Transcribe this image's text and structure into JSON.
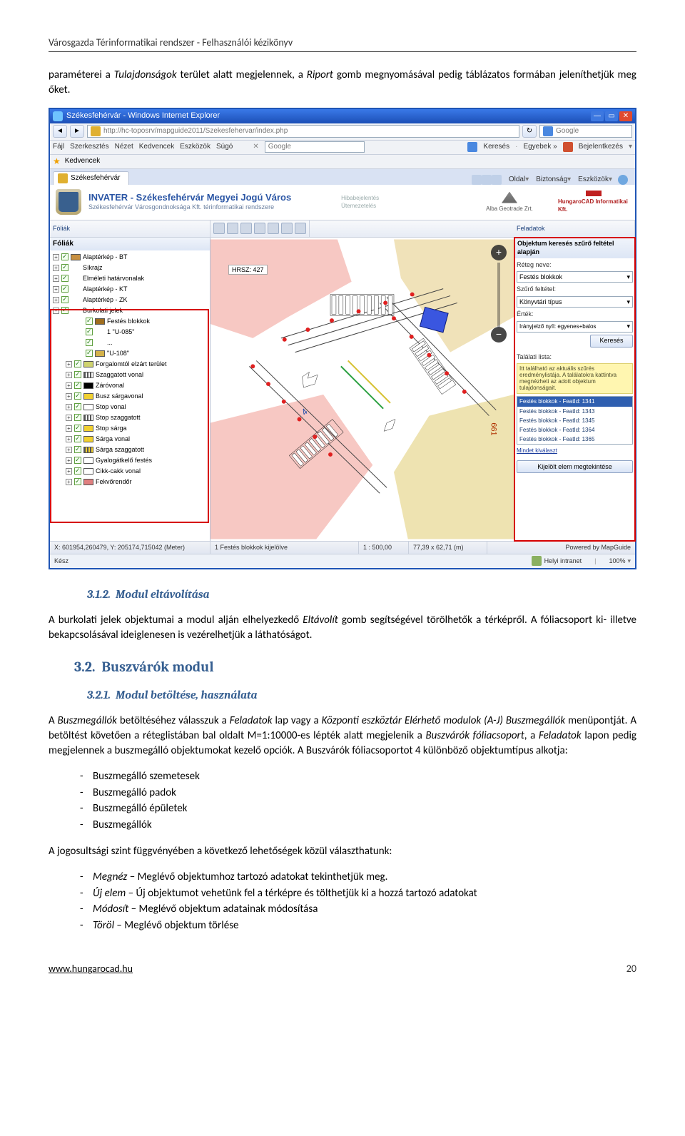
{
  "header": "Városgazda Térinformatikai rendszer - Felhasználói kézikönyv",
  "para1_a": "paraméterei a ",
  "para1_b": "Tulajdonságok",
  "para1_c": " terület alatt megjelennek, a ",
  "para1_d": "Riport",
  "para1_e": " gomb megnyomásával pedig táblázatos formában jeleníthetjük meg őket.",
  "screenshot": {
    "title": "Székesfehérvár - Windows Internet Explorer",
    "address": "http://hc-toposrv/mapguide2011/Szekesfehervar/index.php",
    "search_placeholder": "Google",
    "menu": [
      "Fájl",
      "Szerkesztés",
      "Nézet",
      "Kedvencek",
      "Eszközök",
      "Súgó"
    ],
    "google_box": "Google",
    "menu_right": [
      "Keresés",
      "Egyebek »",
      "Bejelentkezés"
    ],
    "fav_label": "Kedvencek",
    "tab": "Székesfehérvár",
    "tab_right": [
      "Oldal",
      "Biztonság",
      "Eszközök"
    ],
    "banner_title": "INVATER - Székesfehérvár Megyei Jogú Város",
    "banner_sub": "Székesfehérvár Városgondnoksága Kft. térinformatikai rendszere",
    "banner_mid": [
      "Hibabejelentés",
      "Ütemezetelés"
    ],
    "banner_logo1": "Alba Geotrade Zrt.",
    "banner_logo2": "HungaroCAD Informatikai Kft.",
    "toolbar_left": "Fóliák",
    "toolbar_right": "Feladatok",
    "layers_head": "Fóliák",
    "layers": [
      {
        "exp": "+",
        "label": "Alaptérkép - BT",
        "swatch": "#c89040"
      },
      {
        "exp": "+",
        "label": "Síkrajz",
        "swatch": ""
      },
      {
        "exp": "+",
        "label": "Elméleti határvonalak",
        "swatch": ""
      },
      {
        "exp": "+",
        "label": "Alaptérkép - KT",
        "swatch": ""
      },
      {
        "exp": "+",
        "label": "Alaptérkép - ZK",
        "swatch": ""
      },
      {
        "exp": "-",
        "label": "Burkolati jelek",
        "swatch": ""
      }
    ],
    "layers_children": [
      {
        "label": "Festés blokkok",
        "swatch": "#9f6e1f"
      },
      {
        "label": "1  \"U-085\""
      },
      {
        "label": "..."
      },
      {
        "label": "\"U-108\"",
        "swatch": "#d4b24a"
      },
      {
        "label": "Forgalomtól elzárt terület",
        "swatch": "#cfd36e"
      },
      {
        "label": "Szaggatott vonal",
        "swatch": "#ffffff",
        "dash": true
      },
      {
        "label": "Záróvonal",
        "swatch": "#000000"
      },
      {
        "label": "Busz sárgavonal",
        "swatch": "#f0d030"
      },
      {
        "label": "Stop vonal",
        "swatch": "#ffffff"
      },
      {
        "label": "Stop szaggatott",
        "swatch": "#ffffff",
        "dash": true
      },
      {
        "label": "Stop sárga",
        "swatch": "#f0d030"
      },
      {
        "label": "Sárga vonal",
        "swatch": "#f0d030"
      },
      {
        "label": "Sárga szaggatott",
        "swatch": "#f0d030",
        "dash": true
      },
      {
        "label": "Gyalogátkelő festés",
        "swatch": "#ffffff"
      },
      {
        "label": "Cikk-cakk vonal",
        "swatch": "#ffffff"
      },
      {
        "label": "Fekvőrendőr",
        "swatch": "#e08080"
      }
    ],
    "map_label": "HRSZ: 427",
    "right": {
      "head": "Objektum keresés szűrő feltétel alapján",
      "l1": "Réteg neve:",
      "v1": "Festés blokkok",
      "l2": "Szűrő feltétel:",
      "v2": "Könyvtári típus",
      "l3": "Érték:",
      "v3": "Irányjelző nyíl: egyenes+balos",
      "btn_search": "Keresés",
      "list_head": "Találati lista:",
      "tip": "Itt található az aktuális szűrés eredménylistája. A találatokra kattintva megnézheti az adott objektum tulajdonságait.",
      "items": [
        "Festés blokkok - FeatId: 1341",
        "Festés blokkok - FeatId: 1343",
        "Festés blokkok - FeatId: 1345",
        "Festés blokkok - FeatId: 1364",
        "Festés blokkok - FeatId: 1365"
      ],
      "link": "Mindet kiválaszt",
      "btn_view": "Kijelölt elem megtekintése"
    },
    "status": {
      "coord": "X: 601954,260479, Y: 205174,715042 (Meter)",
      "info": "1 Festés blokkok kijelölve",
      "scale": "1 : 500,00",
      "size": "77,39 x 62,71 (m)",
      "powered": "Powered by  MapGuide"
    },
    "bottom": {
      "left": "Kész",
      "intranet": "Helyi intranet",
      "zoom": "100%"
    }
  },
  "sec312_num": "3.1.2.",
  "sec312_title": "Modul eltávolítása",
  "para2_a": "A burkolati jelek objektumai a modul alján elhelyezkedő ",
  "para2_b": "Eltávolít",
  "para2_c": " gomb segítségével törölhetők a térképről. A fóliacsoport ki- illetve bekapcsolásával ideiglenesen is vezérelhetjük a láthatóságot.",
  "sec32_num": "3.2.",
  "sec32_title": "Buszvárók modul",
  "sec321_num": "3.2.1.",
  "sec321_title": "Modul betöltése, használata",
  "para3_a": "A ",
  "para3_b": "Buszmegállók",
  "para3_c": " betöltéséhez válasszuk a ",
  "para3_d": "Feladatok",
  "para3_e": " lap vagy a ",
  "para3_f": "Központi eszköztár Elérhető modulok (A-J) Buszmegállók",
  "para3_g": " menüpontját. A betöltést követően a réteglistában bal oldalt M=1:10000-es lépték alatt megjelenik a ",
  "para3_h": "Buszvárók fóliacsoport",
  "para3_i": ", a ",
  "para3_j": "Feladatok",
  "para3_k": " lapon pedig megjelennek a buszmegálló objektumokat kezelő opciók. A Buszvárók fóliacsoportot 4 különböző objektumtípus alkotja:",
  "list1": [
    "Buszmegálló szemetesek",
    "Buszmegálló padok",
    "Buszmegálló épületek",
    "Buszmegállók"
  ],
  "para4": "A jogosultsági szint függvényében a következő lehetőségek közül választhatunk:",
  "list2": [
    {
      "a": "Megnéz",
      "b": " – Meglévő objektumhoz tartozó adatokat tekinthetjük meg."
    },
    {
      "a": "Új elem",
      "b": " – Új objektumot vehetünk fel a térképre és tölthetjük ki a hozzá tartozó adatokat"
    },
    {
      "a": "Módosít",
      "b": " – Meglévő objektum adatainak módosítása"
    },
    {
      "a": "Töröl",
      "b": " – Meglévő objektum törlése"
    }
  ],
  "footer_link": "www.hungarocad.hu",
  "footer_page": "20"
}
